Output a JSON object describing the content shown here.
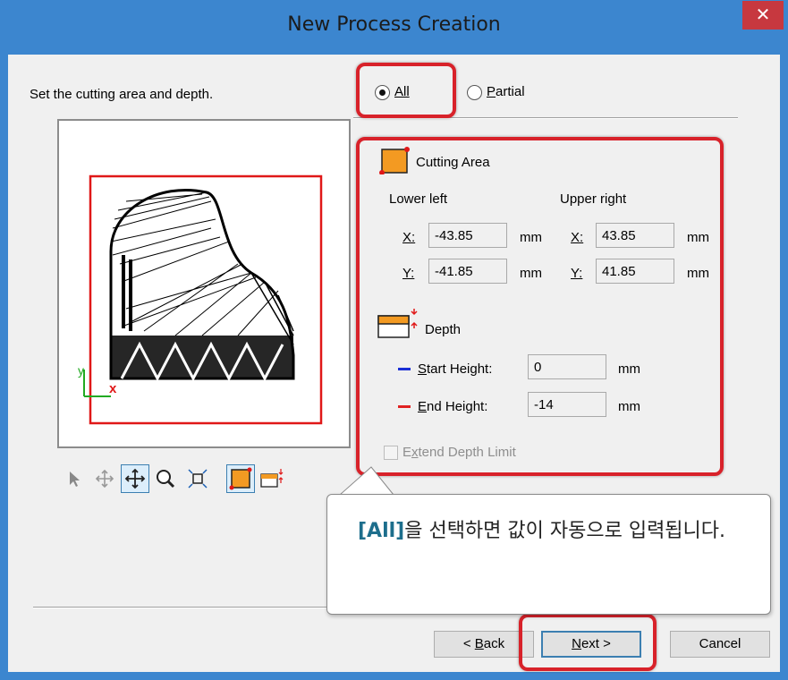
{
  "window": {
    "title": "New Process Creation",
    "close_glyph": "✕"
  },
  "dialog": {
    "instruction": "Set the cutting area and depth.",
    "radio_all": {
      "label": "All",
      "selected": true
    },
    "radio_partial": {
      "label": "Partial",
      "selected": false
    },
    "cutting_area": {
      "heading": "Cutting Area",
      "lower_left_label": "Lower left",
      "upper_right_label": "Upper right",
      "x_label": "X:",
      "y_label": "Y:",
      "lower_left_x": "-43.85",
      "lower_left_y": "-41.85",
      "upper_right_x": "43.85",
      "upper_right_y": "41.85",
      "unit": "mm"
    },
    "depth": {
      "heading": "Depth",
      "start_label": "Start Height:",
      "end_label": "End Height:",
      "start_value": "0",
      "end_value": "-14",
      "unit": "mm",
      "start_color": "#1a2fd6",
      "end_color": "#e02222"
    },
    "extend_depth_limit": {
      "label": "Extend Depth Limit",
      "checked": false,
      "enabled": false
    },
    "preview": {
      "axis_y": "y",
      "axis_x": "x",
      "frame_color": "#e01818"
    },
    "toolbar": [
      "select-arrow-icon",
      "pan-restricted-icon",
      "move-icon",
      "zoom-icon",
      "fit-view-icon",
      "cutting-area-icon",
      "depth-icon"
    ],
    "buttons": {
      "back": "< Back",
      "next": "Next >",
      "cancel": "Cancel"
    }
  },
  "callout": {
    "highlight_term": "[All]",
    "message": "을 선택하면 값이 자동으로 입력됩니다."
  },
  "colors": {
    "title_bar": "#3c86cf",
    "highlight": "#d8222a",
    "close_button": "#c7383f"
  }
}
